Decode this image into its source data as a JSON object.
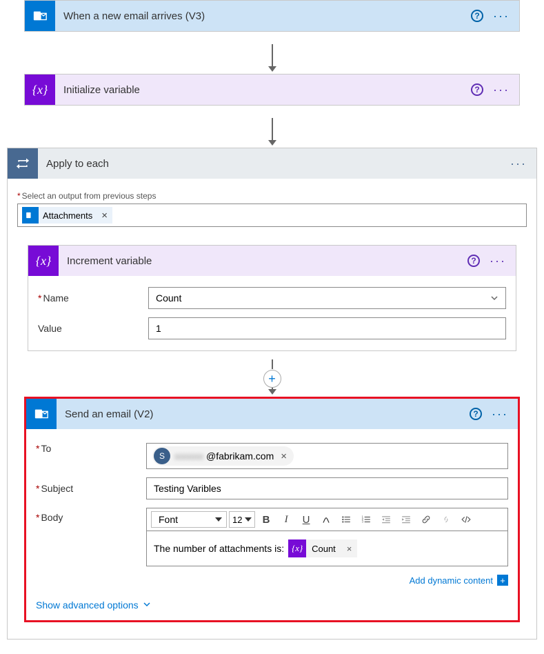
{
  "trigger": {
    "title": "When a new email arrives (V3)"
  },
  "init_var": {
    "title": "Initialize variable"
  },
  "apply_each": {
    "title": "Apply to each",
    "select_label": "Select an output from previous steps",
    "token": "Attachments"
  },
  "increment": {
    "title": "Increment variable",
    "name_label": "Name",
    "name_value": "Count",
    "value_label": "Value",
    "value_value": "1"
  },
  "send_email": {
    "title": "Send an email (V2)",
    "to_label": "To",
    "to_avatar": "S",
    "to_domain": "@fabrikam.com",
    "subject_label": "Subject",
    "subject_value": "Testing Varibles",
    "body_label": "Body",
    "body_text": "The number of attachments is:",
    "body_token": "Count",
    "font_label": "Font",
    "font_size": "12",
    "dyn_link": "Add dynamic content",
    "adv_link": "Show advanced options"
  }
}
